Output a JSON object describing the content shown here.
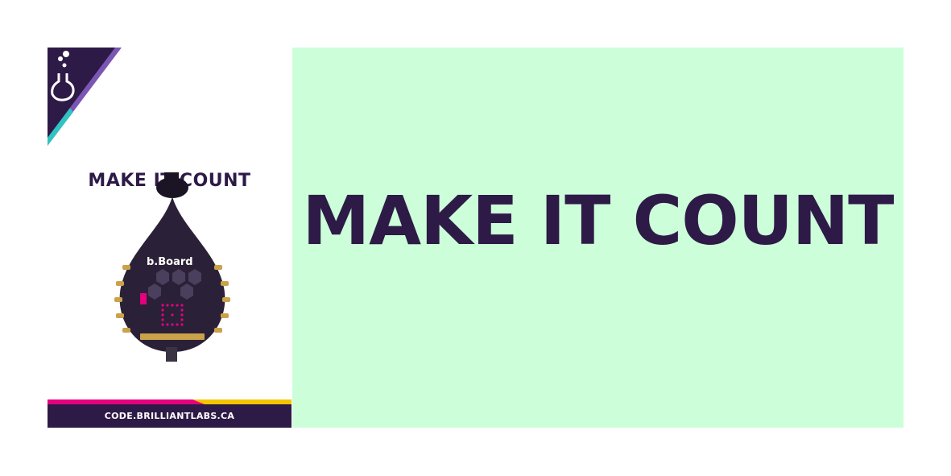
{
  "card": {
    "title": "MAKE IT COUNT",
    "board_label": "b.Board",
    "footer_url": "CODE.BRILLIANTLABS.CA",
    "logo_icon": "flask-icon"
  },
  "panel": {
    "title": "MAKE IT COUNT",
    "background_color": "#ccffd9"
  },
  "colors": {
    "brand_purple": "#2e1a47",
    "accent_teal": "#2ec4c1",
    "accent_pink": "#e6007e",
    "accent_yellow": "#f5c400"
  }
}
